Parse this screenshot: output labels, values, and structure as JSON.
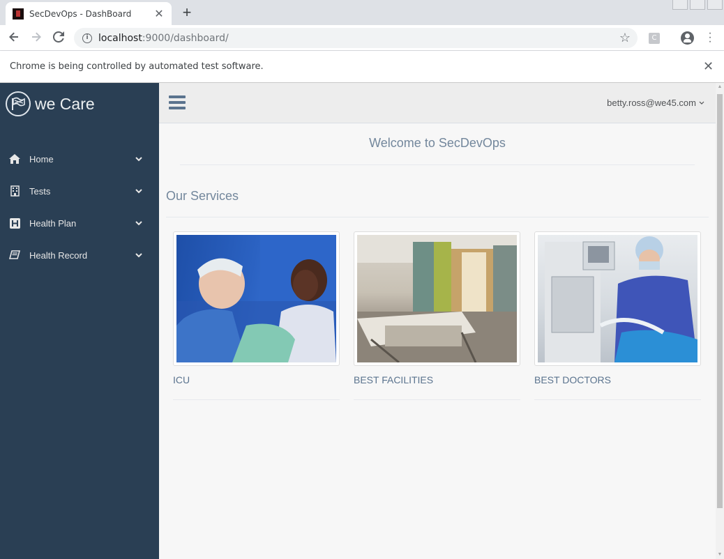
{
  "browser": {
    "tab_title": "SecDevOps - DashBoard",
    "tab_close": "✕",
    "new_tab": "+",
    "url_host": "localhost",
    "url_rest": ":9000/dashboard/",
    "extension_label": "C",
    "infobar_text": "Chrome is being controlled by automated test software.",
    "infobar_close": "✕"
  },
  "sidebar": {
    "brand": "we Care",
    "items": [
      {
        "label": "Home",
        "icon": "home-icon"
      },
      {
        "label": "Tests",
        "icon": "building-icon"
      },
      {
        "label": "Health Plan",
        "icon": "hospital-h-icon"
      },
      {
        "label": "Health Record",
        "icon": "book-icon"
      }
    ]
  },
  "topnav": {
    "user": "betty.ross@we45.com"
  },
  "main": {
    "welcome": "Welcome to SecDevOps",
    "section_title": "Our Services",
    "services": [
      {
        "caption": "ICU"
      },
      {
        "caption": "BEST FACILITIES"
      },
      {
        "caption": "BEST DOCTORS"
      }
    ]
  },
  "colors": {
    "sidebar_bg": "#2a3f54",
    "accent_text": "#73879c",
    "link_text": "#5a738e"
  }
}
